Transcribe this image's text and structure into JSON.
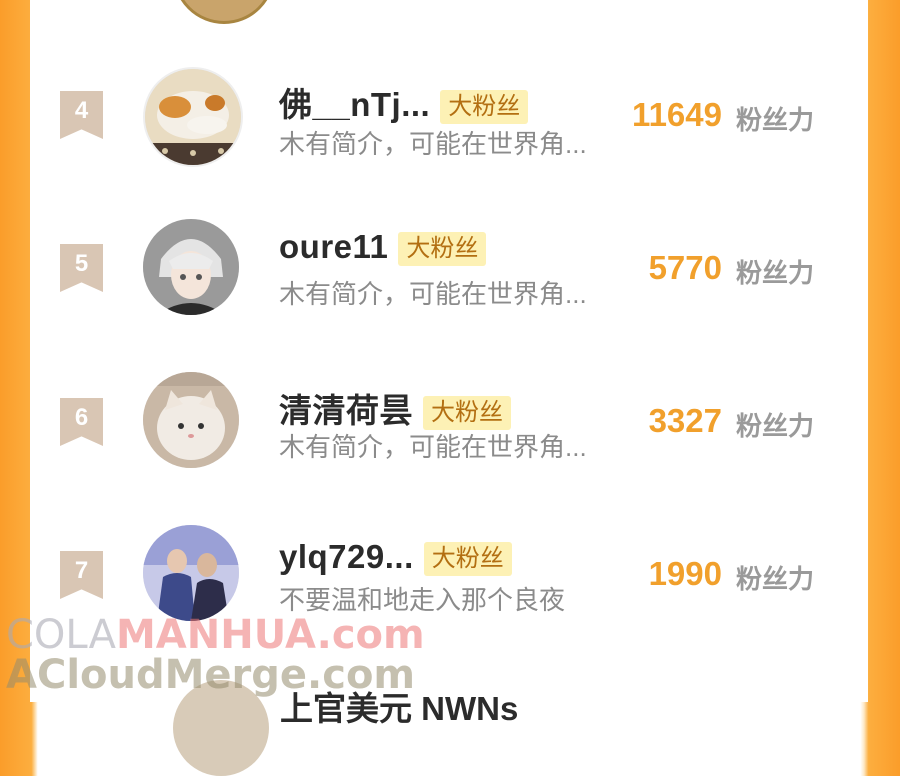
{
  "rows": [
    {
      "rank": "4",
      "name": "佛__nTj...",
      "badge": "大粉丝",
      "bio": "木有简介，可能在世界角...",
      "score": "11649",
      "unit": "粉丝力",
      "avatar": "cat-sleeping-avatar"
    },
    {
      "rank": "5",
      "name": "oure11",
      "badge": "大粉丝",
      "bio": "木有简介，可能在世界角...",
      "score": "5770",
      "unit": "粉丝力",
      "avatar": "anime-boy-avatar"
    },
    {
      "rank": "6",
      "name": "清清荷昙",
      "badge": "大粉丝",
      "bio": "木有简介，可能在世界角...",
      "score": "3327",
      "unit": "粉丝力",
      "avatar": "white-cat-avatar"
    },
    {
      "rank": "7",
      "name": "ylq729...",
      "badge": "大粉丝",
      "bio": "不要温和地走入那个良夜",
      "score": "1990",
      "unit": "粉丝力",
      "avatar": "photo-people-avatar"
    }
  ],
  "watermark": {
    "line1_a": "COLA",
    "line1_b": "MANHUA.com",
    "line2": "ACloudMerge.com"
  },
  "partial_next_name": "上官美元 NWNs"
}
